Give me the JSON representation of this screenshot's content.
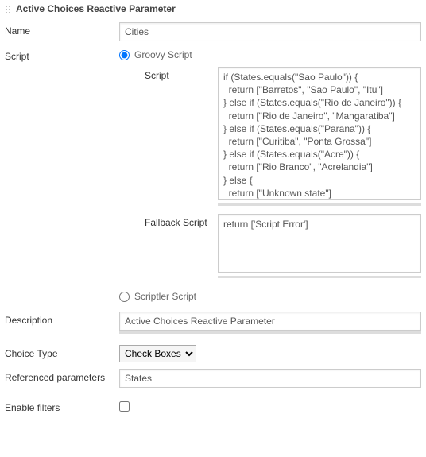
{
  "header": {
    "title": "Active Choices Reactive Parameter"
  },
  "labels": {
    "name": "Name",
    "script": "Script",
    "groovy": "Groovy Script",
    "subScript": "Script",
    "fallback": "Fallback Script",
    "scriptler": "Scriptler Script",
    "description": "Description",
    "choiceType": "Choice Type",
    "refParams": "Referenced parameters",
    "enableFilters": "Enable filters"
  },
  "values": {
    "name": "Cities",
    "scriptCode": "if (States.equals(\"Sao Paulo\")) {\n  return [\"Barretos\", \"Sao Paulo\", \"Itu\"]\n} else if (States.equals(\"Rio de Janeiro\")) {\n  return [\"Rio de Janeiro\", \"Mangaratiba\"]\n} else if (States.equals(\"Parana\")) {\n  return [\"Curitiba\", \"Ponta Grossa\"]\n} else if (States.equals(\"Acre\")) {\n  return [\"Rio Branco\", \"Acrelandia\"]\n} else {\n  return [\"Unknown state\"]\n}",
    "fallbackCode": "return ['Script Error']",
    "description": "Active Choices Reactive Parameter",
    "choiceType": "Check Boxes",
    "refParams": "States"
  }
}
